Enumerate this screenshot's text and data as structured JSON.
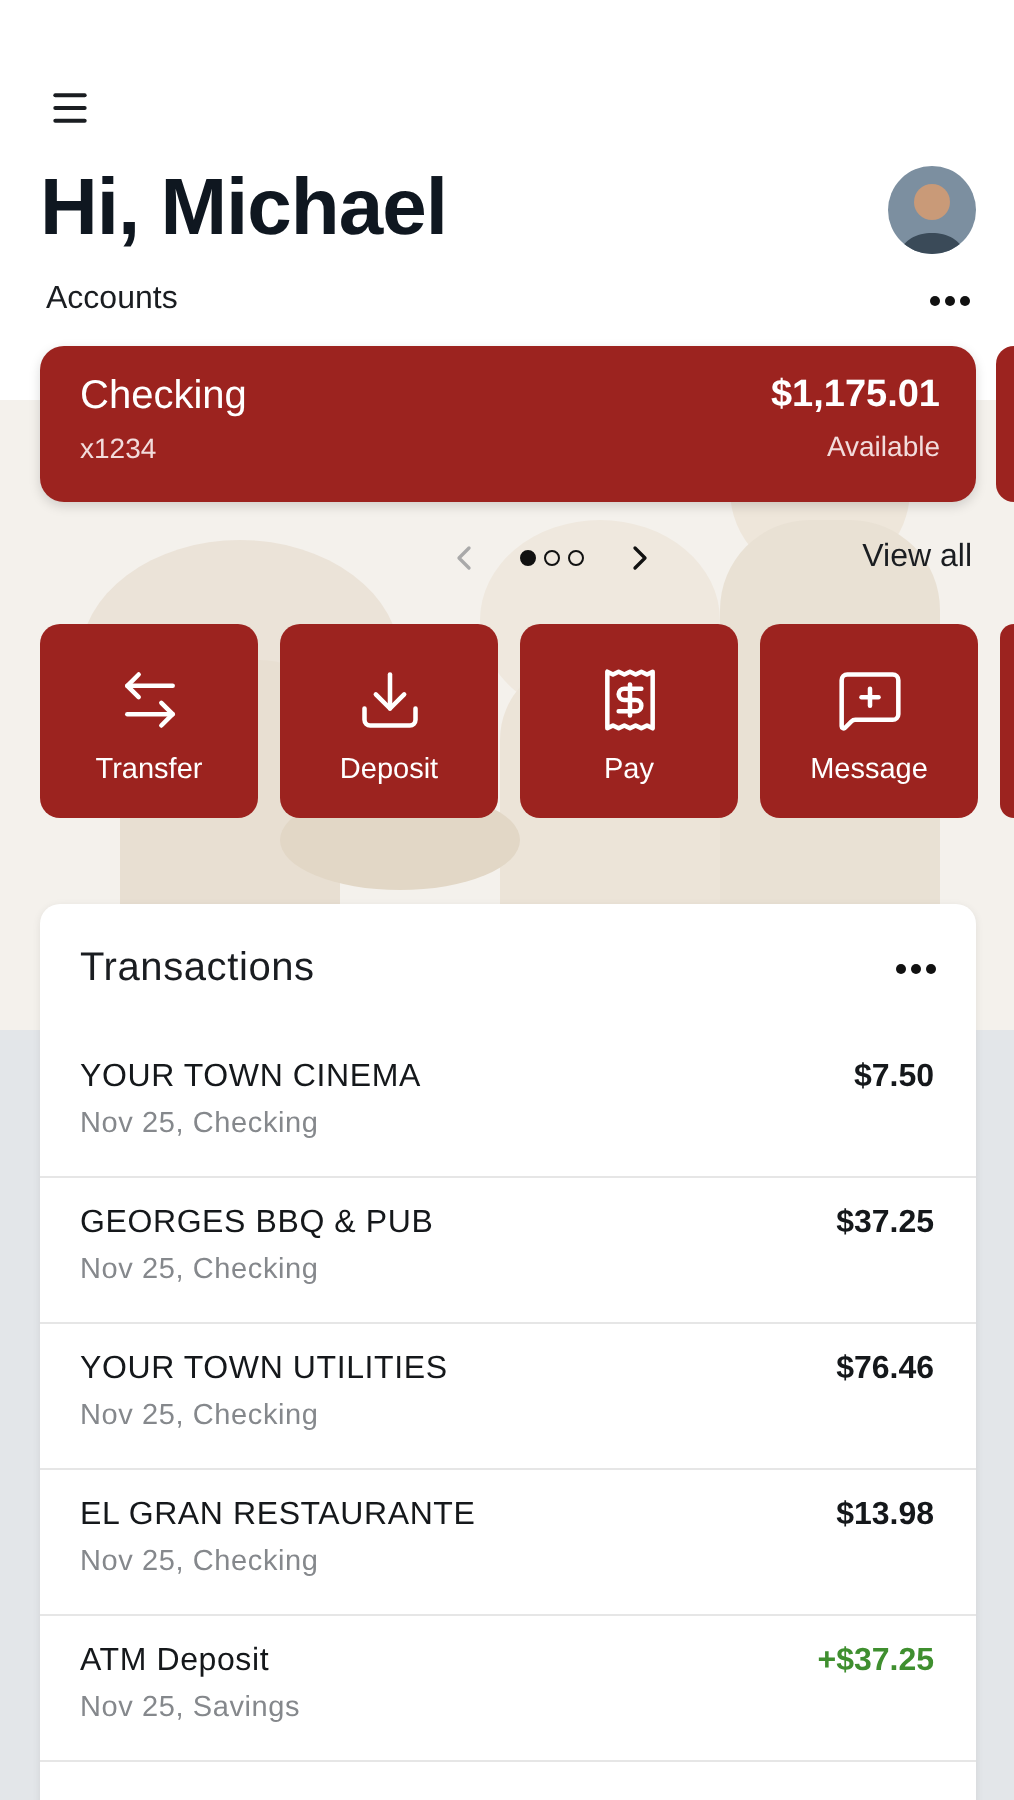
{
  "header": {
    "greeting": "Hi, Michael"
  },
  "accounts": {
    "title": "Accounts",
    "cards": [
      {
        "name": "Checking",
        "number": "x1234",
        "balance": "$1,175.01",
        "balance_label": "Available"
      }
    ],
    "pager": [
      {
        "selected": true
      },
      {
        "selected": false
      },
      {
        "selected": false
      }
    ],
    "prev_disabled": true,
    "next_disabled": false,
    "view_all": "View all"
  },
  "actions": [
    {
      "kind": "transfer",
      "label": "Transfer"
    },
    {
      "kind": "deposit",
      "label": "Deposit"
    },
    {
      "kind": "pay",
      "label": "Pay"
    },
    {
      "kind": "message",
      "label": "Message"
    }
  ],
  "transactions": {
    "title": "Transactions",
    "rows": [
      {
        "name": "YOUR TOWN CINEMA",
        "detail": "Nov 25, Checking",
        "amount": "$7.50",
        "kind": "debit"
      },
      {
        "name": "GEORGES BBQ & PUB",
        "detail": "Nov 25, Checking",
        "amount": "$37.25",
        "kind": "debit"
      },
      {
        "name": "YOUR TOWN UTILITIES",
        "detail": "Nov 25, Checking",
        "amount": "$76.46",
        "kind": "debit"
      },
      {
        "name": "EL GRAN RESTAURANTE",
        "detail": "Nov 25, Checking",
        "amount": "$13.98",
        "kind": "debit"
      },
      {
        "name": "ATM Deposit",
        "detail": "Nov 25, Savings",
        "amount": "+$37.25",
        "kind": "credit"
      }
    ]
  }
}
